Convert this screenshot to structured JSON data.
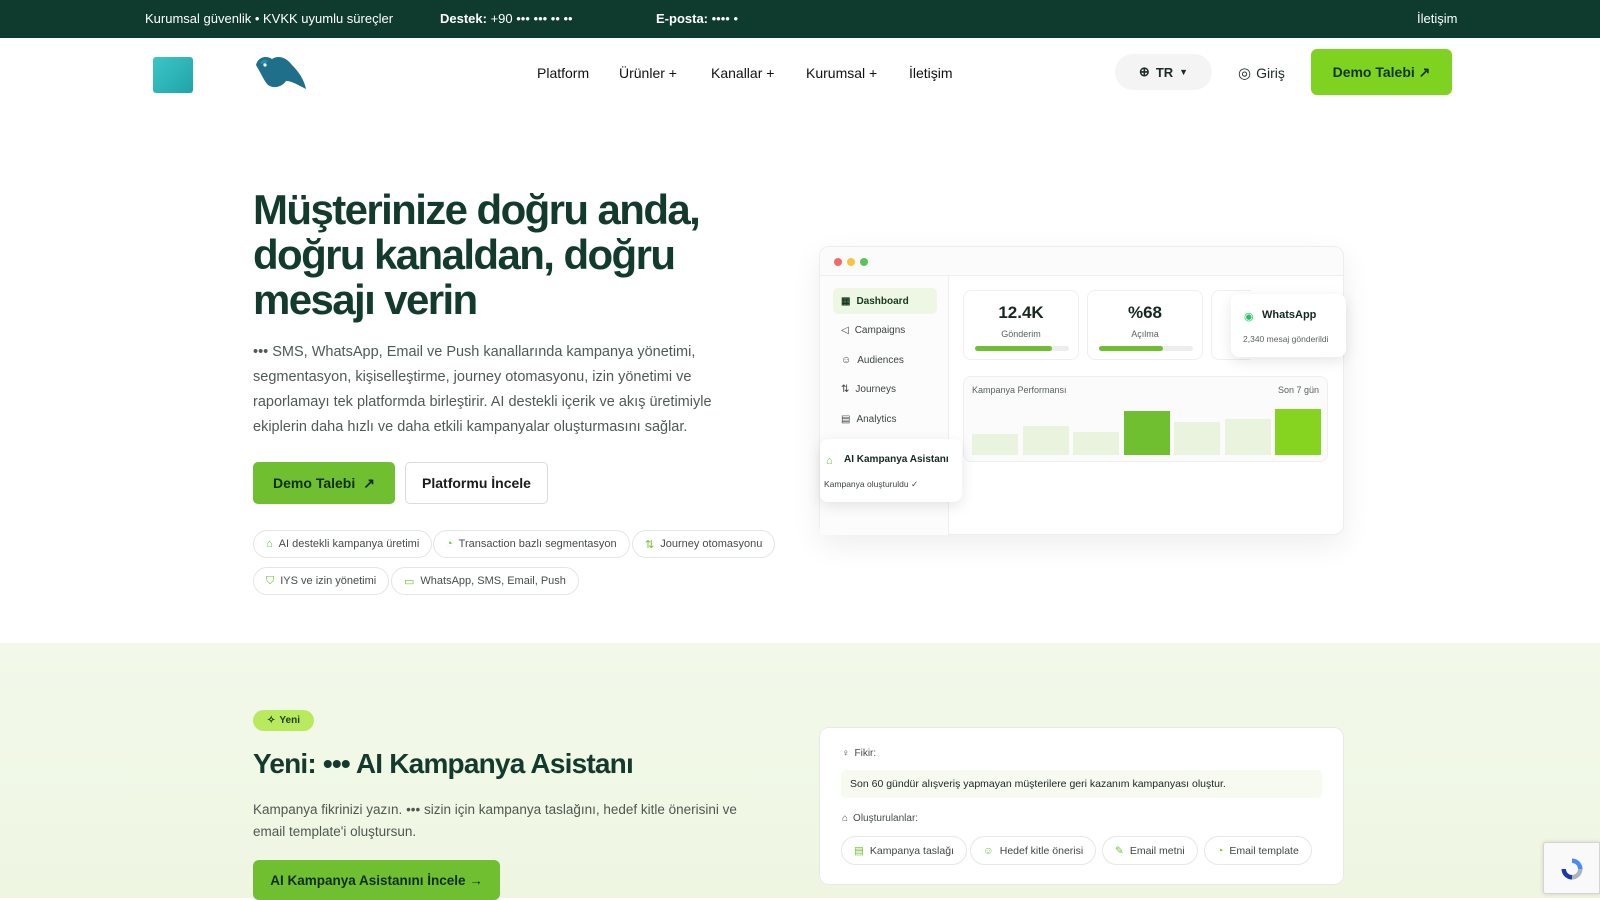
{
  "topbar": {
    "trust": "Kurumsal güvenlik • KVKK uyumlu süreçler",
    "support_label": "Destek:",
    "support_value": "+90 ••• ••• •• ••",
    "email_label": "E-posta:",
    "email_value": "•••• •",
    "contact": "İletişim"
  },
  "nav": {
    "items": [
      {
        "label": "Platform"
      },
      {
        "label": "Ürünler +"
      },
      {
        "label": "Kanallar +"
      },
      {
        "label": "Kurumsal +"
      },
      {
        "label": "İletişim"
      }
    ],
    "lang": "TR",
    "login": "Giriş",
    "demo": "Demo Talebi ↗"
  },
  "hero": {
    "title": "Müşterinize doğru anda, doğru kanaldan, doğru mesajı verin",
    "desc_brand": "•••",
    "desc": "SMS, WhatsApp, Email ve Push kanallarında kampanya yönetimi, segmentasyon, kişiselleştirme, journey otomasyonu, izin yönetimi ve raporlamayı tek platformda birleştirir. AI destekli içerik ve akış üretimiyle ekiplerin daha hızlı ve daha etkili kampanyalar oluşturmasını sağlar.",
    "btn_demo": "Demo Talebi",
    "btn_demo_arrow": "↗",
    "btn_platform": "Platformu İncele",
    "chips": [
      {
        "icon": "⌂",
        "label": "AI destekli kampanya üretimi"
      },
      {
        "icon": "◔",
        "label": "Transaction bazlı segmentasyon"
      },
      {
        "icon": "⇅",
        "label": "Journey otomasyonu"
      },
      {
        "icon": "⛉",
        "label": "IYS ve izin yönetimi"
      },
      {
        "icon": "▭",
        "label": "WhatsApp, SMS, Email, Push"
      }
    ]
  },
  "dashboard": {
    "sidebar": [
      {
        "icon": "▦",
        "label": "Dashboard"
      },
      {
        "icon": "◁",
        "label": "Campaigns"
      },
      {
        "icon": "☺",
        "label": "Audiences"
      },
      {
        "icon": "⇅",
        "label": "Journeys"
      },
      {
        "icon": "▤",
        "label": "Analytics"
      }
    ],
    "stats": [
      {
        "value": "12.4K",
        "label": "Gönderim",
        "progress": 0.82
      },
      {
        "value": "%68",
        "label": "Açılma",
        "progress": 0.68
      }
    ],
    "whatsapp": {
      "title": "WhatsApp",
      "sub": "2,340 mesaj gönderildi"
    },
    "perf_title": "Kampanya Performansı",
    "perf_period": "Son 7 gün",
    "perf_bars": [
      0.45,
      0.62,
      0.5,
      0.95,
      0.72,
      0.78,
      1.0
    ],
    "perf_bar_colors": [
      "#eaf3dd",
      "#eaf3dd",
      "#eaf3dd",
      "#6fbf30",
      "#eaf3dd",
      "#eaf3dd",
      "#86d41f"
    ],
    "ai": {
      "title": "AI Kampanya Asistanı",
      "sub": "Kampanya oluşturuldu ✓"
    }
  },
  "section2": {
    "badge": "Yeni",
    "title_prefix": "Yeni:",
    "title_brand": "•••",
    "title_suffix": "AI Kampanya Asistanı",
    "desc_a": "Kampanya fikrinizi yazın.",
    "desc_brand": "•••",
    "desc_b": "sizin için kampanya taslağını, hedef kitle önerisini ve email template'i oluştursun.",
    "cta": "AI Kampanya Asistanını İncele →",
    "idea_label": "Fikir:",
    "idea_text": "Son 60 gündür alışveriş yapmayan müşterilere geri kazanım kampanyası oluştur.",
    "outputs_label": "Oluşturulanlar:",
    "outputs": [
      {
        "icon": "▤",
        "label": "Kampanya taslağı"
      },
      {
        "icon": "☺",
        "label": "Hedef kitle önerisi"
      },
      {
        "icon": "✎",
        "label": "Email metni"
      },
      {
        "icon": "◔",
        "label": "Email template"
      }
    ]
  },
  "colors": {
    "accent": "#7ed321",
    "dark": "#0f3a2e",
    "soft": "#f3f9ea"
  }
}
